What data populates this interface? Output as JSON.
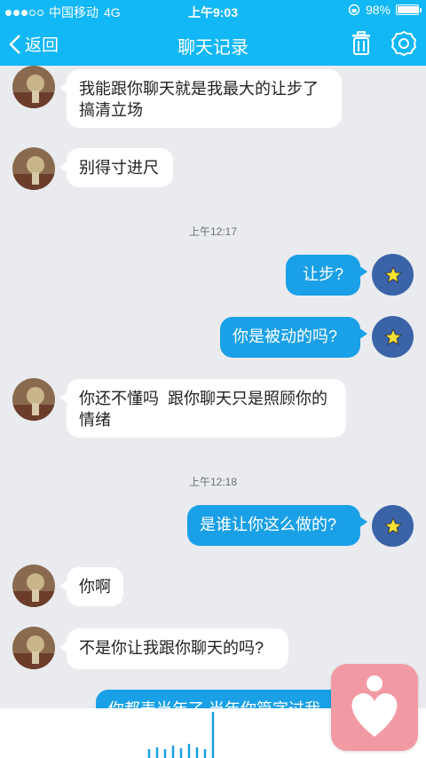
{
  "status": {
    "carrier": "中国移动",
    "network": "4G",
    "time": "上午9:03",
    "battery": "98%",
    "battery_level": 0.98
  },
  "nav": {
    "back_label": "返回",
    "title": "聊天记录"
  },
  "messages": [
    {
      "from": "them",
      "text_line1": "我能跟你聊天就是我最大的让步了",
      "text_line2": "搞清立场"
    },
    {
      "from": "them",
      "text": "别得寸进尺"
    },
    {
      "timestamp": "上午12:17"
    },
    {
      "from": "me",
      "text": "让步?"
    },
    {
      "from": "me",
      "text": "你是被动的吗?"
    },
    {
      "from": "them",
      "text_line1": "你还不懂吗  跟你聊天只是照顾你的",
      "text_line2": "情绪"
    },
    {
      "timestamp": "上午12:18"
    },
    {
      "from": "me",
      "text": "是谁让你这么做的?"
    },
    {
      "from": "them",
      "text": "你啊"
    },
    {
      "from": "them",
      "text": "不是你让我跟你聊天的吗?"
    },
    {
      "from": "me",
      "text": "你都表当年了  当年你篇字过我"
    }
  ],
  "colors": {
    "accent": "#12b7f5",
    "bubble_out": "#1aa0e6",
    "background": "#e9ebef",
    "heart_app": "#f29aa4"
  }
}
